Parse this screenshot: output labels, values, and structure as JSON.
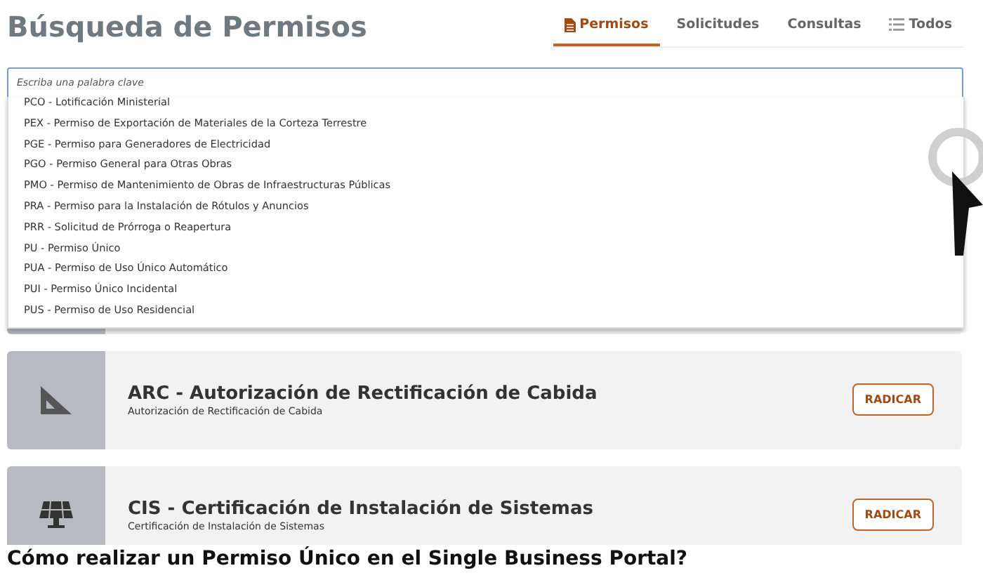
{
  "title": "Búsqueda de Permisos",
  "tabs": [
    {
      "label": "Permisos",
      "selected": true,
      "kind": "document"
    },
    {
      "label": "Solicitudes",
      "selected": false,
      "kind": "plain"
    },
    {
      "label": "Consultas",
      "selected": false,
      "kind": "plain"
    },
    {
      "label": "Todos",
      "selected": false,
      "kind": "list"
    }
  ],
  "search": {
    "placeholder": "Escriba una palabra clave"
  },
  "suggestions": [
    "PCO - Lotificación Ministerial",
    "PEX - Permiso de Exportación de Materiales de la Corteza Terrestre",
    "PGE - Permiso para Generadores de Electricidad",
    "PGO - Permiso General para Otras Obras",
    "PMO - Permiso de Mantenimiento de Obras de Infraestructuras Públicas",
    "PRA - Permiso para la Instalación de Rótulos y Anuncios",
    "PRR - Solicitud de Prórroga o Reapertura",
    "PU - Permiso Único",
    "PUA - Permiso de Uso Único Automático",
    "PUI - Permiso Único Incidental",
    "PUS - Permiso de Uso Residencial"
  ],
  "cards": [
    {
      "kind": "set-square",
      "title": "ARC - Autorización de Rectificación de Cabida",
      "subtitle": "Autorización de Rectificación de Cabida",
      "button": "RADICAR"
    },
    {
      "kind": "solar-panel",
      "title": "CIS - Certificación de Instalación de Sistemas",
      "subtitle": "Certificación de Instalación de Sistemas",
      "button": "RADICAR"
    }
  ],
  "footer_heading": "Cómo realizar un Permiso Único en el Single Business Portal?"
}
